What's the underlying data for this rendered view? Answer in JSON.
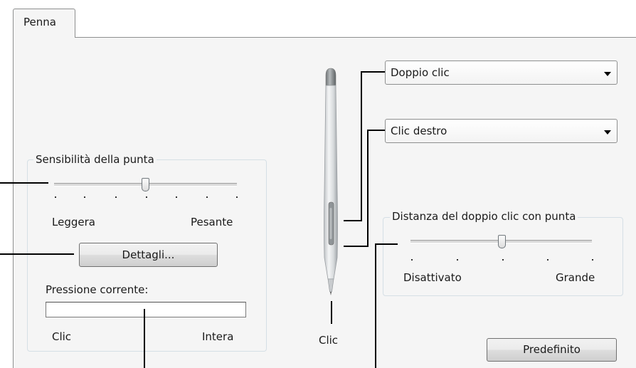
{
  "tab": {
    "label": "Penna"
  },
  "tip_sensitivity": {
    "legend": "Sensibilità della punta",
    "min_label": "Leggera",
    "max_label": "Pesante",
    "level": 0.5,
    "details_button": "Dettagli...",
    "pressure_label": "Pressione corrente:",
    "pressure_min": "Clic",
    "pressure_max": "Intera"
  },
  "pen_buttons": {
    "upper_button": "Doppio clic",
    "lower_button": "Clic destro",
    "tip_label": "Clic"
  },
  "double_click_distance": {
    "legend": "Distanza del doppio clic con punta",
    "min_label": "Disattivato",
    "max_label": "Grande",
    "level": 0.5
  },
  "default_button": "Predefinito"
}
